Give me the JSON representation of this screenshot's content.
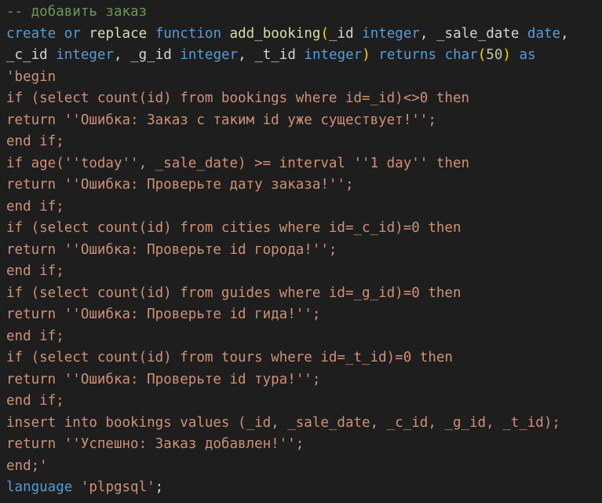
{
  "colors": {
    "background": "#1e1e1e",
    "comment": "#6a9955",
    "keyword": "#569cd6",
    "function": "#dcdcaa",
    "default": "#d4d4d4",
    "number": "#b5cea8",
    "string": "#ce9178",
    "bracket": "#ffd700"
  },
  "code": {
    "l1": "-- добавить заказ",
    "l2": {
      "create": "create",
      "or": "or",
      "replace": "replace",
      "function": "function",
      "fname": "add_booking",
      "open": "(",
      "p1": "_id",
      "t1": "integer",
      "c1": ",",
      "p2": "_sale_date",
      "t2": "date",
      "c2": ","
    },
    "l3": {
      "p3": "_c_id",
      "t3": "integer",
      "c3": ",",
      "p4": "_g_id",
      "t4": "integer",
      "c4": ",",
      "p5": "_t_id",
      "t5": "integer",
      "close": ")",
      "returns": "returns",
      "char": "char",
      "open2": "(",
      "n50": "50",
      "close2": ")",
      "as": "as"
    },
    "body": [
      "'begin",
      "if (select count(id) from bookings where id=_id)<>0 then",
      "return ''Ошибка: Заказ с таким id уже существует!'';",
      "end if;",
      "if age(''today'', _sale_date) >= interval ''1 day'' then",
      "return ''Ошибка: Проверьте дату заказа!'';",
      "end if;",
      "if (select count(id) from cities where id=_c_id)=0 then",
      "return ''Ошибка: Проверьте id города!'';",
      "end if;",
      "if (select count(id) from guides where id=_g_id)=0 then",
      "return ''Ошибка: Проверьте id гида!'';",
      "end if;",
      "if (select count(id) from tours where id=_t_id)=0 then",
      "return ''Ошибка: Проверьте id тура!'';",
      "end if;",
      "insert into bookings values (_id, _sale_date, _c_id, _g_id, _t_id);",
      "return ''Успешно: Заказ добавлен!'';",
      "end;'"
    ],
    "last": {
      "language": "language",
      "lang_value": "'plpgsql'",
      "semi": ";"
    }
  }
}
